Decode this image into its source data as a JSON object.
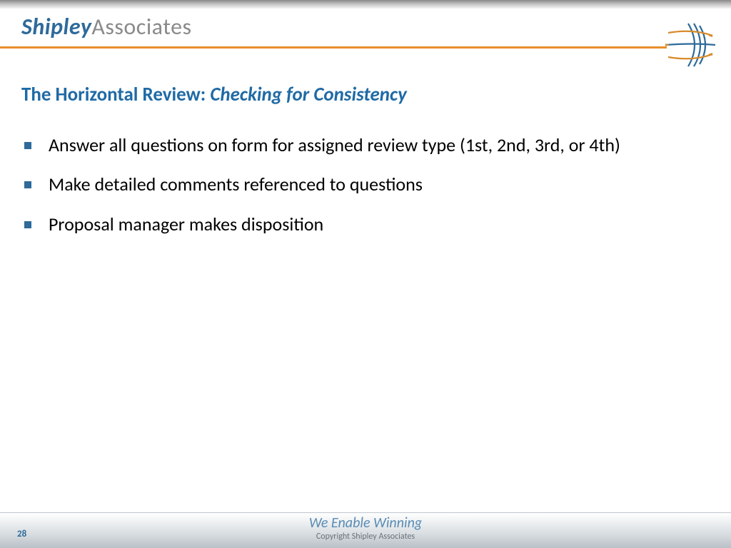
{
  "brand": {
    "primary": "Shipley",
    "secondary": "Associates"
  },
  "title": {
    "prefix": "The Horizontal Review: ",
    "emphasis": "Checking for Consistency"
  },
  "bullets": [
    "Answer all questions on form for assigned review type (1st, 2nd, 3rd, or 4th)",
    "Make detailed comments referenced to questions",
    "Proposal manager makes disposition"
  ],
  "footer": {
    "page": "28",
    "tagline": "We Enable Winning",
    "copyright": "Copyright Shipley Associates"
  }
}
